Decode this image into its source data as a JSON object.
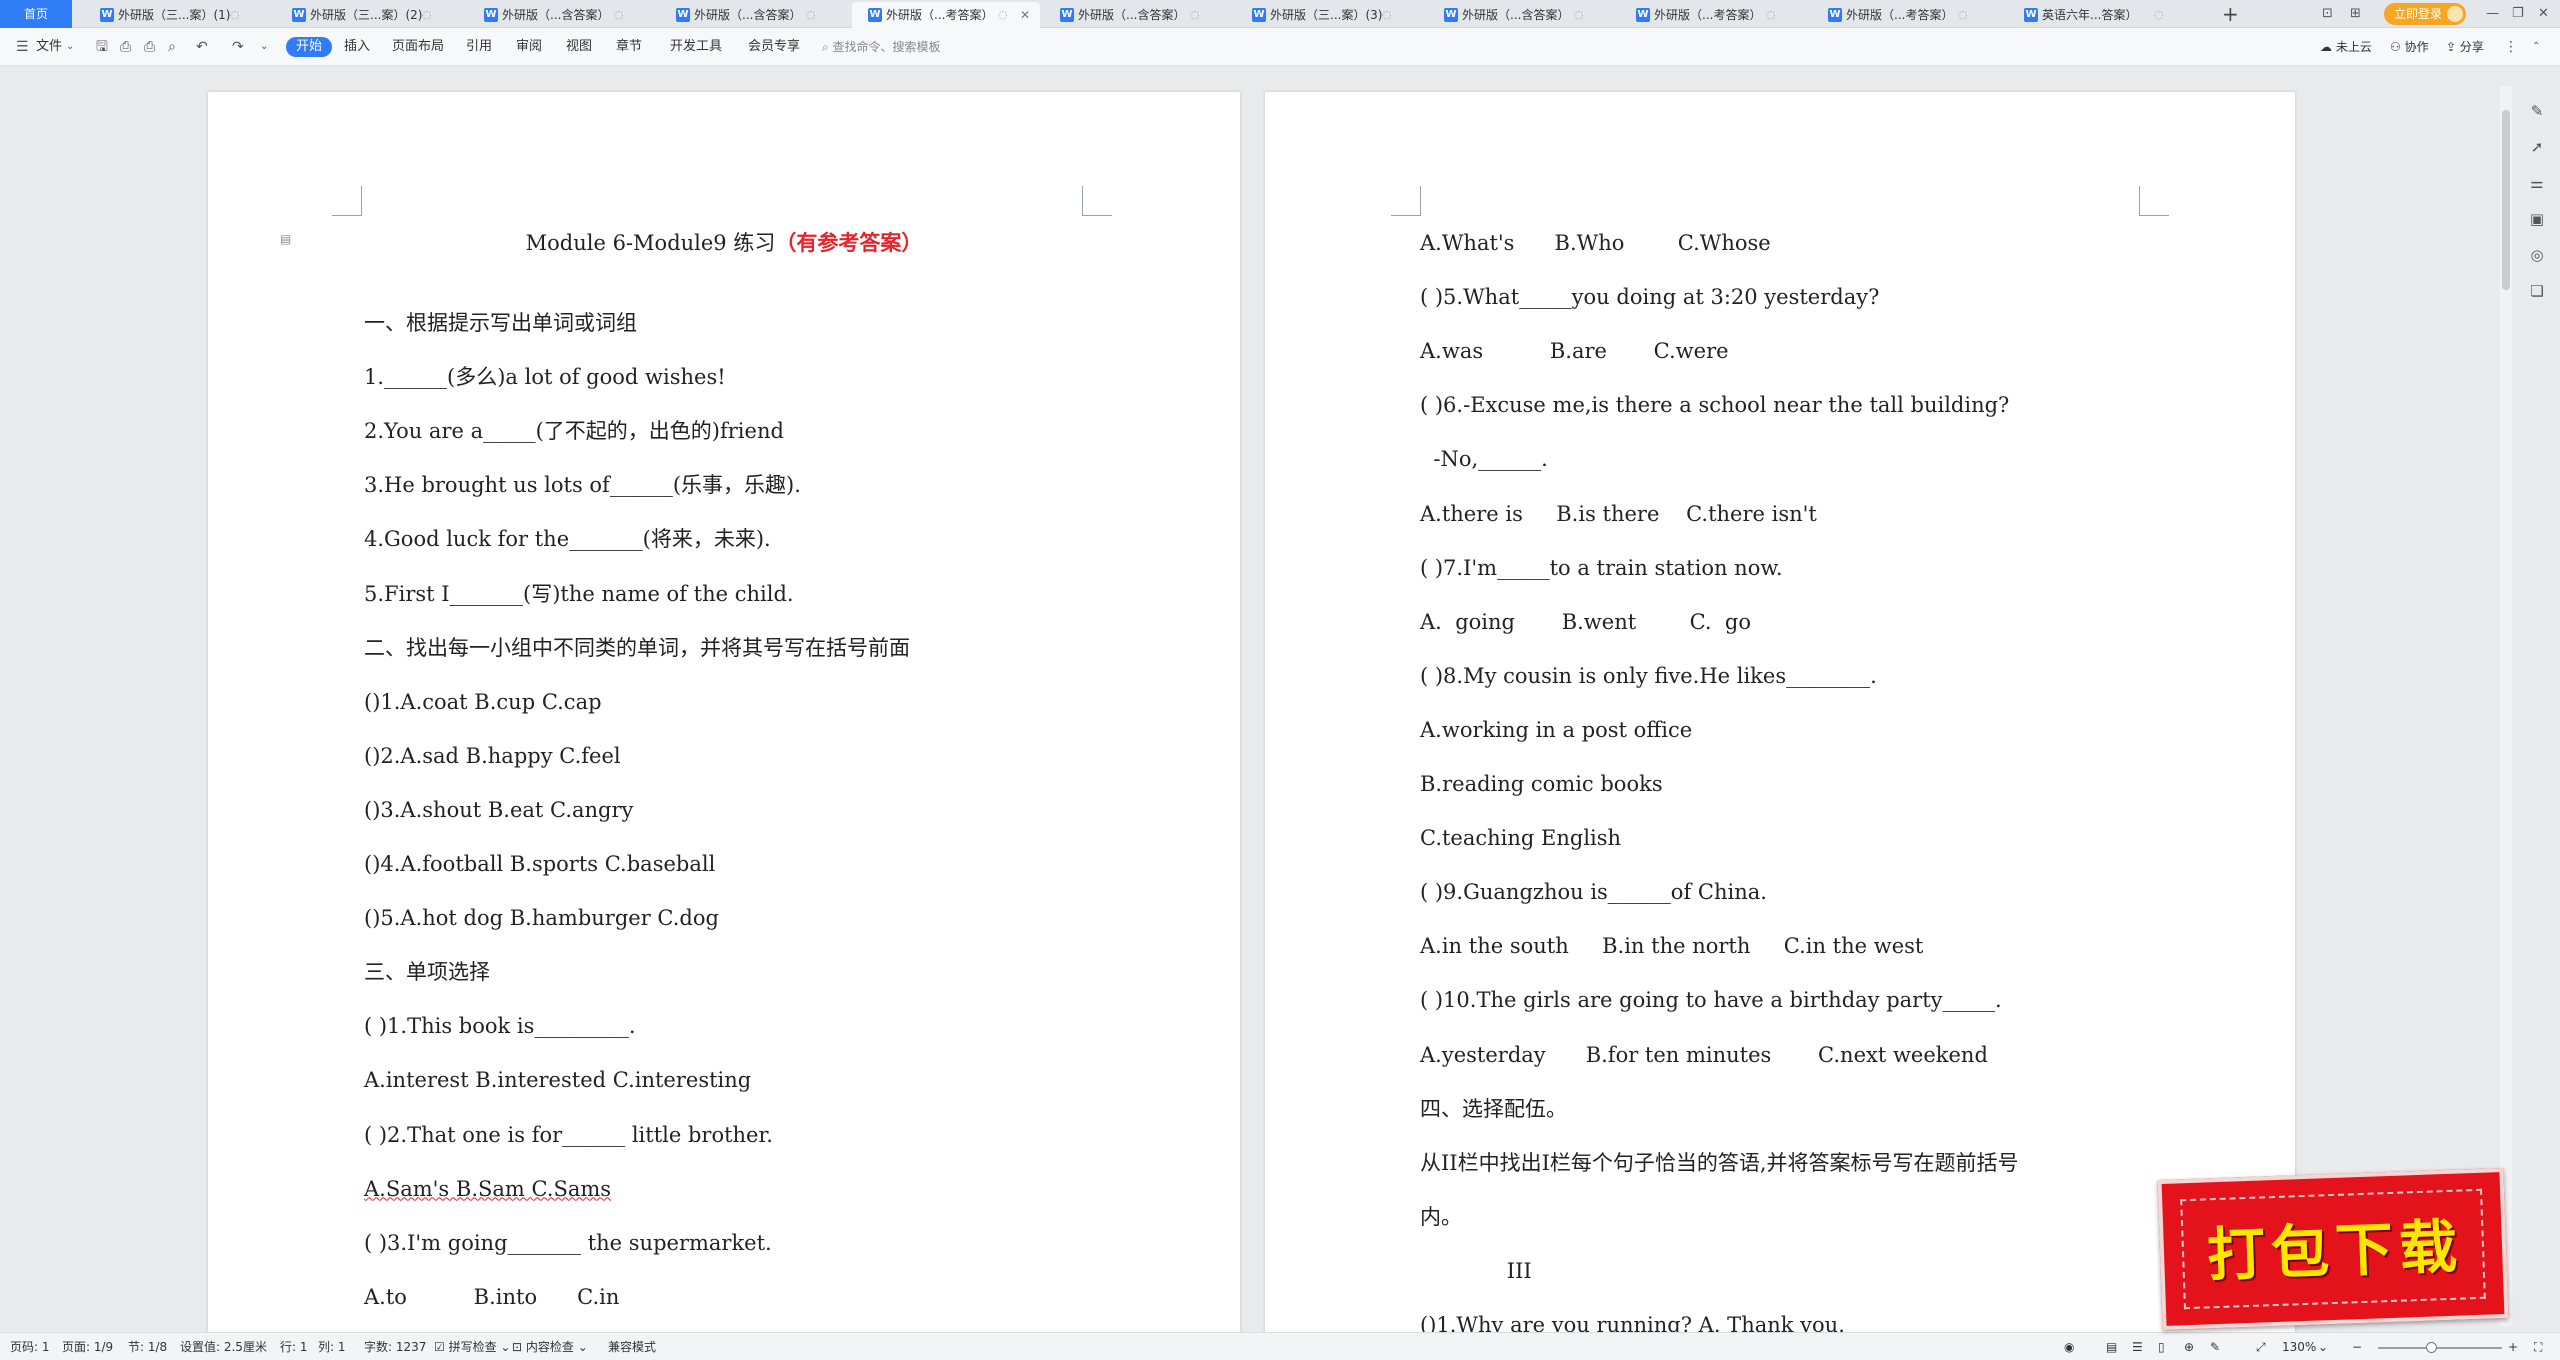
{
  "tabs": {
    "home": "首页",
    "docs": [
      "外研版（三...案）(1)",
      "外研版（三...案）(2)",
      "外研版（...含答案）",
      "外研版（...含答案）",
      "外研版（...考答案）",
      "外研版（...含答案）",
      "外研版（三...案）(3)",
      "外研版（...含答案）",
      "外研版（...考答案）",
      "外研版（...考答案）",
      "英语六年...答案）"
    ],
    "add": "+",
    "login": "立即登录"
  },
  "ribbon": {
    "file": "文件",
    "tabs": [
      "开始",
      "插入",
      "页面布局",
      "引用",
      "审阅",
      "视图",
      "章节",
      "开发工具",
      "会员专享"
    ],
    "search": "查找命令、搜索模板",
    "right": [
      "未上云",
      "协作",
      "分享"
    ]
  },
  "page1": {
    "title_plain": "Module 6-Module9 练习",
    "title_red": "（有参考答案）",
    "lines": [
      "一、根据提示写出单词或词组",
      "1.______(多么)a lot of good wishes!",
      "2.You are a_____(了不起的，出色的)friend",
      "3.He brought us lots of______(乐事，乐趣).",
      "4.Good luck for the_______(将来，未来).",
      "5.First I_______(写)the name of the child.",
      "二、找出每一小组中不同类的单词，并将其号写在括号前面",
      "()1.A.coat B.cup C.cap",
      "()2.A.sad B.happy C.feel",
      "()3.A.shout B.eat C.angry",
      "()4.A.football B.sports C.baseball",
      "()5.A.hot dog B.hamburger C.dog",
      "三、单项选择",
      "( )1.This book is_________.",
      "A.interest B.interested C.interesting",
      "( )2.That one is for______ little brother.",
      "A.Sam's B.Sam C.Sams",
      "( )3.I'm going_______ the supermarket.",
      "A.to          B.into      C.in"
    ]
  },
  "page2": {
    "lines": [
      "A.What's      B.Who        C.Whose",
      "( )5.What_____you doing at 3:20 yesterday?",
      "A.was          B.are       C.were",
      "( )6.-Excuse me,is there a school near the tall building?",
      "  -No,______.",
      "A.there is     B.is there    C.there isn't",
      "( )7.I'm_____to a train station now.",
      "A.  going       B.went        C.  go",
      "( )8.My cousin is only five.He likes________.",
      "A.working in a post office",
      "B.reading comic books",
      "C.teaching English",
      "( )9.Guangzhou is______of China.",
      "A.in the south     B.in the north     C.in the west",
      "( )10.The girls are going to have a birthday party_____.",
      "A.yesterday      B.for ten minutes       C.next weekend",
      "四、选择配伍。",
      "从II栏中找出I栏每个句子恰当的答语,并将答案标号写在题前括号",
      "内。",
      "             III",
      "()1.Why are you running? A. Thank you."
    ]
  },
  "statusbar": {
    "page_code": "页码: 1",
    "pages": "页面: 1/9",
    "section": "节: 1/8",
    "setting": "设置值: 2.5厘米",
    "row": "行: 1",
    "col": "列: 1",
    "words": "字数: 1237",
    "spell": "拼写检查",
    "content": "内容检查",
    "compat": "兼容模式",
    "zoom": "130%"
  },
  "badge": {
    "text": "打包下载"
  }
}
